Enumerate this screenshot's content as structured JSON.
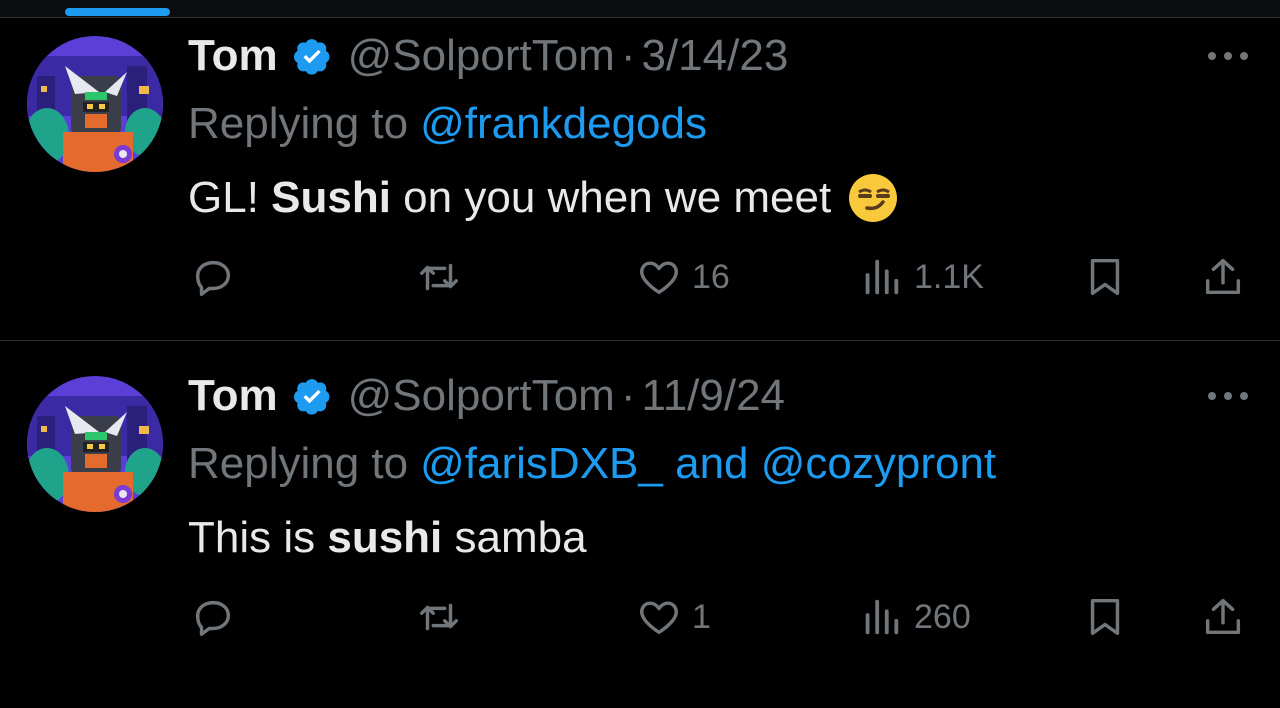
{
  "tweets": [
    {
      "name": "Tom",
      "handle": "@SolportTom",
      "separator": "·",
      "date": "3/14/23",
      "replying_prefix": "Replying to",
      "replying_to": "@frankdegods",
      "text": {
        "before": "GL! ",
        "bold": "Sushi",
        "after": " on you when we meet"
      },
      "emoji": "smirking-face",
      "stats": {
        "likes": "16",
        "views": "1.1K"
      }
    },
    {
      "name": "Tom",
      "handle": "@SolportTom",
      "separator": "·",
      "date": "11/9/24",
      "replying_prefix": "Replying to",
      "replying_to": "@farisDXB_ and @cozypront",
      "text": {
        "before": "This is ",
        "bold": "sushi",
        "after": " samba"
      },
      "emoji": "",
      "stats": {
        "likes": "1",
        "views": "260"
      }
    }
  ],
  "colors": {
    "background": "#000000",
    "text_primary": "#e7e9ea",
    "text_secondary": "#71767b",
    "accent": "#1d9bf0",
    "divider": "#2f3336"
  },
  "icons": {
    "verified": "verified-badge-icon",
    "more": "more-icon",
    "reply": "reply-icon",
    "retweet": "retweet-icon",
    "like": "heart-icon",
    "views": "views-icon",
    "bookmark": "bookmark-icon",
    "share": "share-icon"
  }
}
